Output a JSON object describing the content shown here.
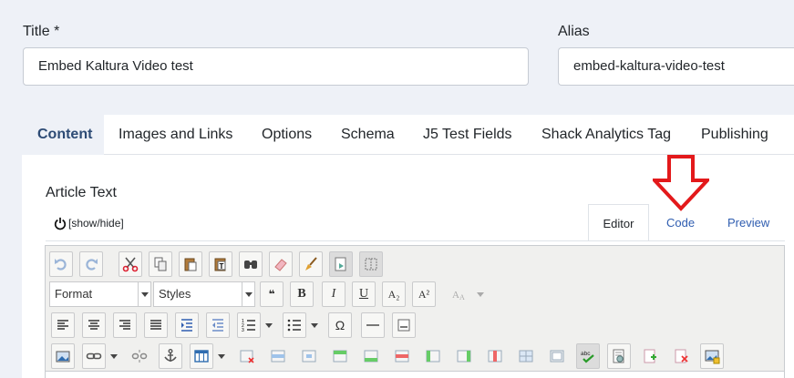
{
  "fields": {
    "title_label": "Title *",
    "title_value": "Embed Kaltura Video test",
    "alias_label": "Alias",
    "alias_value": "embed-kaltura-video-test"
  },
  "tabs": [
    {
      "label": "Content",
      "active": true
    },
    {
      "label": "Images and Links"
    },
    {
      "label": "Options"
    },
    {
      "label": "Schema"
    },
    {
      "label": "J5 Test Fields"
    },
    {
      "label": "Shack Analytics Tag"
    },
    {
      "label": "Publishing"
    }
  ],
  "editor": {
    "label": "Article Text",
    "toggle_label": "[show/hide]",
    "tabs": {
      "editor": "Editor",
      "code": "Code",
      "preview": "Preview"
    },
    "format_select": "Format",
    "styles_select": "Styles",
    "bold": "B",
    "italic": "I",
    "underline": "U",
    "subscript": "A₂",
    "superscript": "A²",
    "omega": "Ω",
    "quote": "❝",
    "icons": {
      "row1": [
        "undo-icon",
        "redo-icon",
        "cut-icon",
        "copy-icon",
        "paste-icon",
        "paste-text-icon",
        "find-icon",
        "eraser-icon",
        "clean-icon",
        "template-icon",
        "blocks-icon"
      ],
      "row3": [
        "align-left-icon",
        "align-center-icon",
        "align-right-icon",
        "align-justify-icon",
        "indent-icon",
        "outdent-icon",
        "ordered-list-icon",
        "unordered-list-icon",
        "omega-icon",
        "horizontal-rule-icon",
        "pagebreak-icon"
      ],
      "row4": [
        "image-icon",
        "link-icon",
        "unlink-icon",
        "anchor-icon",
        "table-icon",
        "spellcheck-icon",
        "media-icon"
      ]
    }
  },
  "colors": {
    "accent": "#2d4b75",
    "link": "#2f5db0",
    "annotation_arrow": "#e3191b",
    "page_bg": "#eef1f7"
  }
}
